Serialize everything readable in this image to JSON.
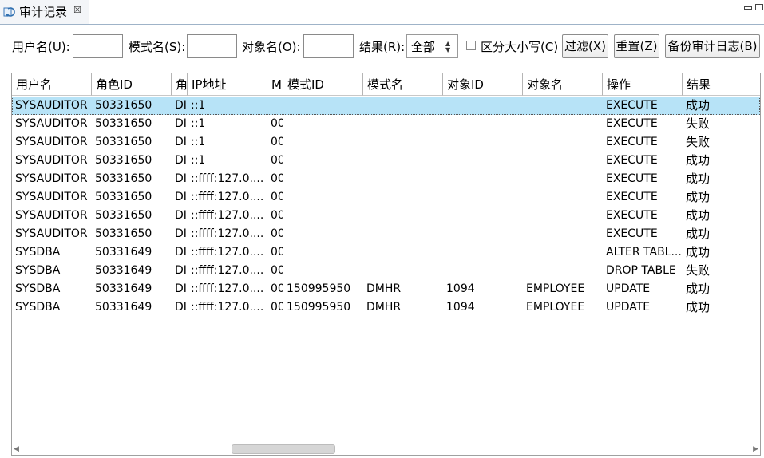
{
  "tab": {
    "title": "审计记录",
    "close_label": "☒"
  },
  "filter": {
    "user_label": "用户名(U):",
    "schema_label": "模式名(S):",
    "object_label": "对象名(O):",
    "result_label": "结果(R):",
    "result_value": "全部",
    "case_label": "区分大小写(C)",
    "filter_button": "过滤(X)",
    "reset_button": "重置(Z)",
    "backup_button": "备份审计日志(B)"
  },
  "table": {
    "columns": [
      "用户名",
      "角色ID",
      "角",
      "IP地址",
      "M",
      "模式ID",
      "模式名",
      "对象ID",
      "对象名",
      "操作",
      "结果"
    ],
    "rows": [
      [
        "SYSAUDITOR",
        "50331650",
        "DI",
        "::1",
        "",
        "",
        "",
        "",
        "",
        "EXECUTE",
        "成功"
      ],
      [
        "SYSAUDITOR",
        "50331650",
        "DI",
        "::1",
        "00",
        "",
        "",
        "",
        "",
        "EXECUTE",
        "失败"
      ],
      [
        "SYSAUDITOR",
        "50331650",
        "DI",
        "::1",
        "00",
        "",
        "",
        "",
        "",
        "EXECUTE",
        "失败"
      ],
      [
        "SYSAUDITOR",
        "50331650",
        "DI",
        "::1",
        "00",
        "",
        "",
        "",
        "",
        "EXECUTE",
        "成功"
      ],
      [
        "SYSAUDITOR",
        "50331650",
        "DI",
        "::ffff:127.0....",
        "00",
        "",
        "",
        "",
        "",
        "EXECUTE",
        "成功"
      ],
      [
        "SYSAUDITOR",
        "50331650",
        "DI",
        "::ffff:127.0....",
        "00",
        "",
        "",
        "",
        "",
        "EXECUTE",
        "成功"
      ],
      [
        "SYSAUDITOR",
        "50331650",
        "DI",
        "::ffff:127.0....",
        "00",
        "",
        "",
        "",
        "",
        "EXECUTE",
        "成功"
      ],
      [
        "SYSAUDITOR",
        "50331650",
        "DI",
        "::ffff:127.0....",
        "00",
        "",
        "",
        "",
        "",
        "EXECUTE",
        "成功"
      ],
      [
        "SYSDBA",
        "50331649",
        "DI",
        "::ffff:127.0....",
        "00",
        "",
        "",
        "",
        "",
        "ALTER TABL...",
        "成功"
      ],
      [
        "SYSDBA",
        "50331649",
        "DI",
        "::ffff:127.0....",
        "00",
        "",
        "",
        "",
        "",
        "DROP TABLE",
        "失败"
      ],
      [
        "SYSDBA",
        "50331649",
        "DI",
        "::ffff:127.0....",
        "00",
        "150995950",
        "DMHR",
        "1094",
        "EMPLOYEE",
        "UPDATE",
        "成功"
      ],
      [
        "SYSDBA",
        "50331649",
        "DI",
        "::ffff:127.0....",
        "00",
        "150995950",
        "DMHR",
        "1094",
        "EMPLOYEE",
        "UPDATE",
        "成功"
      ]
    ]
  }
}
